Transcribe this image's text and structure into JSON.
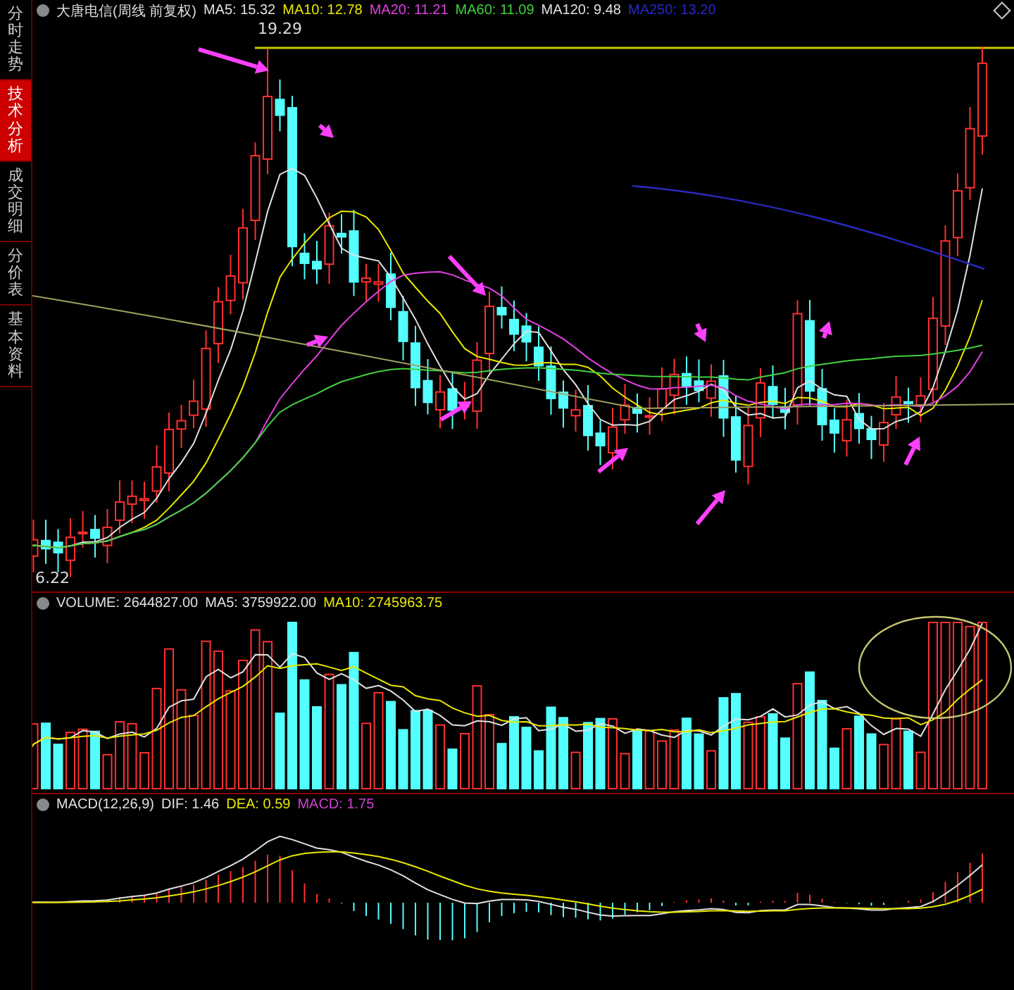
{
  "side_tabs": [
    {
      "label": "分时走势",
      "selected": false
    },
    {
      "label": "技术分析",
      "selected": true
    },
    {
      "label": "成交明细",
      "selected": false
    },
    {
      "label": "分价表",
      "selected": false
    },
    {
      "label": "基本资料",
      "selected": false
    }
  ],
  "main_panel": {
    "title": "大唐电信(周线 前复权)",
    "indicators": [
      {
        "label": "MA5: 15.32",
        "color": "#e0e0e0"
      },
      {
        "label": "MA10: 12.78",
        "color": "#e8e800"
      },
      {
        "label": "MA20: 11.21",
        "color": "#e040e0"
      },
      {
        "label": "MA60: 11.09",
        "color": "#40d040"
      },
      {
        "label": "MA120: 9.48",
        "color": "#e0e0e0"
      },
      {
        "label": "MA250: 13.20",
        "color": "#2828c8"
      }
    ],
    "high_label": "19.29",
    "low_label": "6.22"
  },
  "volume_panel": {
    "indicators": [
      {
        "label": "VOLUME: 2644827.00",
        "color": "#e0e0e0"
      },
      {
        "label": "MA5: 3759922.00",
        "color": "#e0e0e0"
      },
      {
        "label": "MA10: 2745963.75",
        "color": "#e8e800"
      }
    ]
  },
  "macd_panel": {
    "indicators": [
      {
        "label": "MACD(12,26,9)",
        "color": "#e0e0e0"
      },
      {
        "label": "DIF: 1.46",
        "color": "#e0e0e0"
      },
      {
        "label": "DEA: 0.59",
        "color": "#e8e800"
      },
      {
        "label": "MACD: 1.75",
        "color": "#d040d0"
      }
    ]
  }
}
